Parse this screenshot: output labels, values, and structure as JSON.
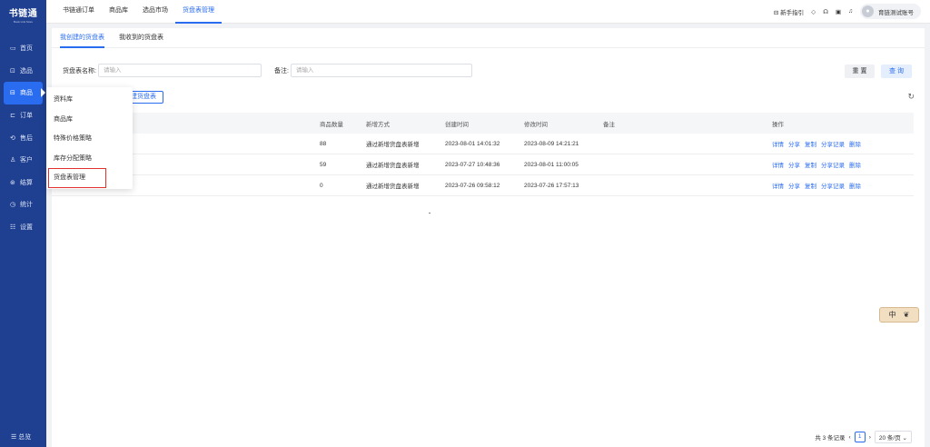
{
  "sidebar": {
    "logo": "书链通",
    "logo_sub": "Book Link Store",
    "items": [
      {
        "icon": "▭",
        "label": "首页"
      },
      {
        "icon": "⊡",
        "label": "选品"
      },
      {
        "icon": "⊟",
        "label": "商品"
      },
      {
        "icon": "⊏",
        "label": "订单"
      },
      {
        "icon": "⟲",
        "label": "售后"
      },
      {
        "icon": "♙",
        "label": "客户"
      },
      {
        "icon": "⊛",
        "label": "结算"
      },
      {
        "icon": "◷",
        "label": "统计"
      },
      {
        "icon": "☷",
        "label": "设置"
      }
    ],
    "collapse": "☰ 总览"
  },
  "topbar": {
    "tabs": [
      "书链通订单",
      "商品库",
      "选品市场",
      "货盘表管理"
    ],
    "guide": "⊟ 新手指引",
    "icons": [
      "◇",
      "☊",
      "▣",
      "♫"
    ],
    "user": "育链测试账号"
  },
  "subtabs": [
    "我创建的货盘表",
    "我收到的货盘表"
  ],
  "filters": {
    "name_label": "货盘表名称:",
    "name_placeholder": "请输入",
    "remark_label": "备注:",
    "remark_placeholder": "请输入",
    "reset": "重 置",
    "query": "查 询"
  },
  "add_button": "新增货盘表",
  "add_button_visible": "建货盘表",
  "table": {
    "headers": [
      "商品数量",
      "新增方式",
      "创建时间",
      "修改时间",
      "备注",
      "操作"
    ],
    "rows": [
      {
        "count": "88",
        "method": "通过新增货盘表新增",
        "created": "2023-08-01 14:01:32",
        "modified": "2023-08-09 14:21:21",
        "remark": ""
      },
      {
        "count": "59",
        "method": "通过新增货盘表新增",
        "created": "2023-07-27 10:48:36",
        "modified": "2023-08-01 11:00:05",
        "remark": ""
      },
      {
        "count": "0",
        "method": "通过新增货盘表新增",
        "created": "2023-07-26 09:58:12",
        "modified": "2023-07-26 17:57:13",
        "remark": ""
      }
    ],
    "ops": [
      "详情",
      "分享",
      "复制",
      "分享记录",
      "删除"
    ]
  },
  "dropdown": [
    "资料库",
    "商品库",
    "特殊价格策略",
    "库存分配策略",
    "货盘表管理"
  ],
  "pagination": {
    "total": "共 3 条记录",
    "page": "1",
    "size": "20 条/页"
  },
  "widget": {
    "lang": "中",
    "icon": "❦"
  }
}
